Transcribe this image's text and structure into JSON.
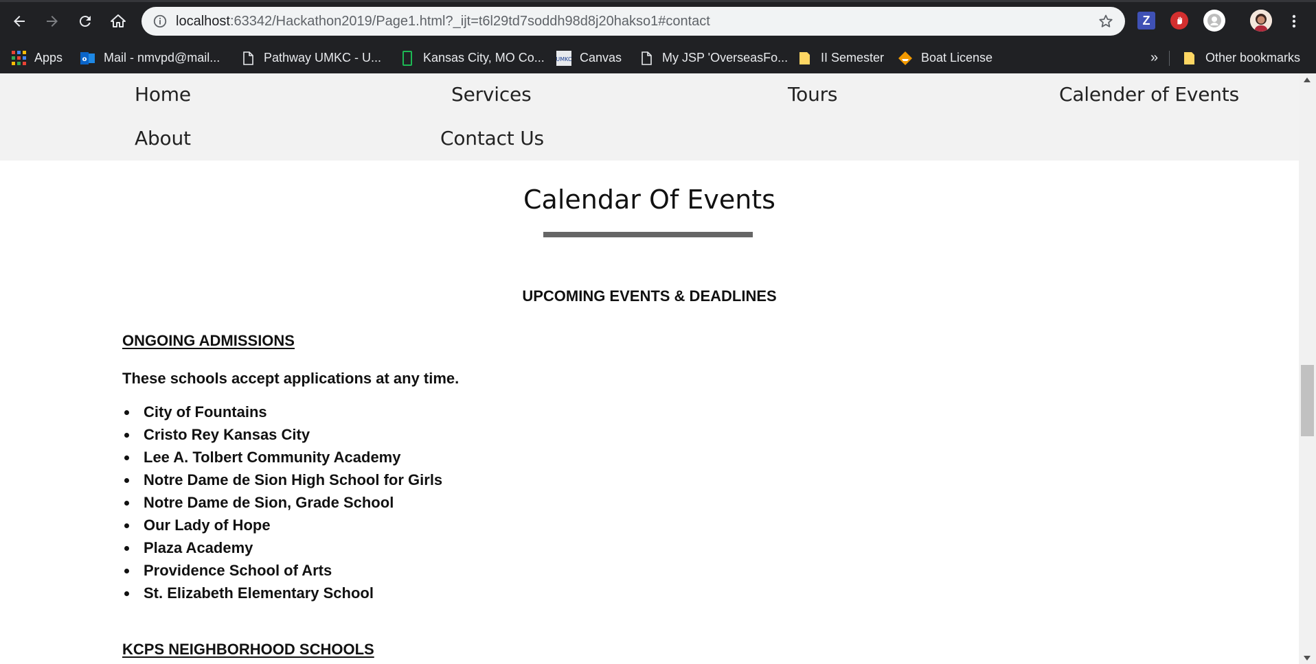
{
  "browser": {
    "url_host": "localhost",
    "url_rest": ":63342/Hackathon2019/Page1.html?_ijt=t6l29td7soddh98d8j20hakso1#contact",
    "bookmarks": [
      {
        "label": "Apps",
        "icon": "apps-grid-icon"
      },
      {
        "label": "Mail - nmvpd@mail...",
        "icon": "outlook-icon"
      },
      {
        "label": "Pathway UMKC - U...",
        "icon": "page-icon"
      },
      {
        "label": "Kansas City, MO Co...",
        "icon": "green-doc-icon"
      },
      {
        "label": "Canvas",
        "icon": "umkc-icon"
      },
      {
        "label": "My JSP 'OverseasFo...",
        "icon": "page-icon"
      },
      {
        "label": "II Semester",
        "icon": "folder-icon"
      },
      {
        "label": "Boat License",
        "icon": "boat-icon"
      }
    ],
    "overflow_label": "»",
    "other_bookmarks": "Other bookmarks",
    "ext_z_label": "Z"
  },
  "nav": {
    "home": "Home",
    "services": "Services",
    "tours": "Tours",
    "calendar": "Calender of Events",
    "about": "About",
    "contact": "Contact Us"
  },
  "page": {
    "title": "Calendar Of Events",
    "subheading": "UPCOMING EVENTS & DEADLINES",
    "group1_heading": "ONGOING ADMISSIONS",
    "group1_note": "These schools accept applications at any time.",
    "schools": [
      "City of Fountains",
      "Cristo Rey Kansas City",
      "Lee A. Tolbert Community Academy",
      "Notre Dame de Sion High School for Girls",
      "Notre Dame de Sion, Grade School",
      "Our Lady of Hope",
      "Plaza Academy",
      "Providence School of Arts",
      "St. Elizabeth Elementary School"
    ],
    "group2_heading": "KCPS NEIGHBORHOOD SCHOOLS"
  },
  "colors": {
    "chrome_bg": "#202124",
    "omnibox_bg": "#f1f3f4",
    "nav_bg": "#f2f2f2",
    "title_rule": "#666666"
  }
}
